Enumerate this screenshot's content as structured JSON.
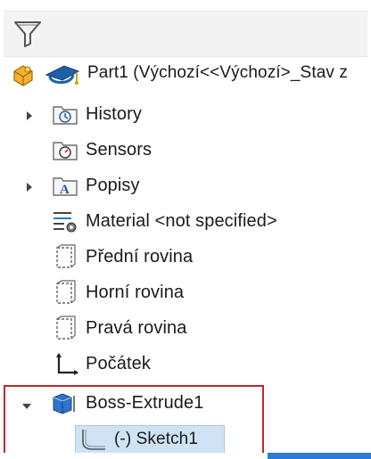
{
  "tree": {
    "root_label": "Part1  (Výchozí<<Výchozí>_Stav z",
    "items": [
      {
        "label": "History"
      },
      {
        "label": "Sensors"
      },
      {
        "label": "Popisy"
      },
      {
        "label": "Material <not specified>"
      },
      {
        "label": "Přední rovina"
      },
      {
        "label": "Horní rovina"
      },
      {
        "label": "Pravá rovina"
      },
      {
        "label": "Počátek"
      },
      {
        "label": "Boss-Extrude1"
      },
      {
        "label": "(-) Sketch1"
      }
    ]
  },
  "colors": {
    "highlight_border": "#c1272d",
    "selection_fill": "#cfe3f5",
    "accent": "#2a7bd4"
  }
}
